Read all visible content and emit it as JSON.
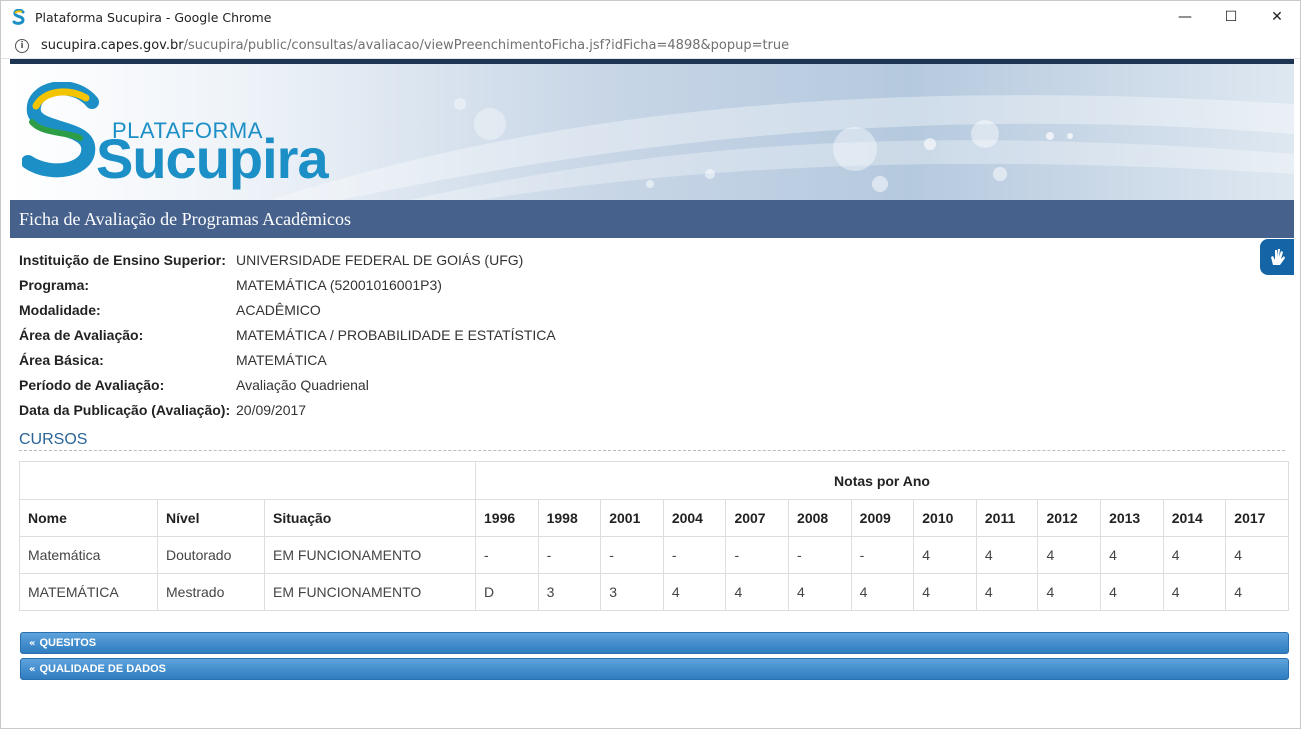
{
  "window": {
    "title": "Plataforma Sucupira - Google Chrome",
    "controls": {
      "minimize": "—",
      "maximize": "☐",
      "close": "✕"
    }
  },
  "address": {
    "domain": "sucupira.capes.gov.br",
    "path": "/sucupira/public/consultas/avaliacao/viewPreenchimentoFicha.jsf?idFicha=4898&popup=true"
  },
  "logo": {
    "small": "PLATAFORMA",
    "big": "Sucupira"
  },
  "section_title": "Ficha de Avaliação de Programas Acadêmicos",
  "details": [
    {
      "label": "Instituição de Ensino Superior:",
      "value": "UNIVERSIDADE FEDERAL DE GOIÁS (UFG)"
    },
    {
      "label": "Programa:",
      "value": "MATEMÁTICA (52001016001P3)"
    },
    {
      "label": "Modalidade:",
      "value": "ACADÊMICO"
    },
    {
      "label": "Área de Avaliação:",
      "value": "MATEMÁTICA / PROBABILIDADE E ESTATÍSTICA"
    },
    {
      "label": "Área Básica:",
      "value": "MATEMÁTICA"
    },
    {
      "label": "Período de Avaliação:",
      "value": "Avaliação Quadrienal"
    },
    {
      "label": "Data da Publicação (Avaliação):",
      "value": "20/09/2017"
    }
  ],
  "cursos": {
    "title": "CURSOS",
    "group_header": "Notas por Ano",
    "columns": [
      "Nome",
      "Nível",
      "Situação"
    ],
    "years": [
      "1996",
      "1998",
      "2001",
      "2004",
      "2007",
      "2008",
      "2009",
      "2010",
      "2011",
      "2012",
      "2013",
      "2014",
      "2017"
    ],
    "rows": [
      {
        "nome": "Matemática",
        "nivel": "Doutorado",
        "situacao": "EM FUNCIONAMENTO",
        "notas": [
          "-",
          "-",
          "-",
          "-",
          "-",
          "-",
          "-",
          "4",
          "4",
          "4",
          "4",
          "4",
          "4"
        ]
      },
      {
        "nome": "MATEMÁTICA",
        "nivel": "Mestrado",
        "situacao": "EM FUNCIONAMENTO",
        "notas": [
          "D",
          "3",
          "3",
          "4",
          "4",
          "4",
          "4",
          "4",
          "4",
          "4",
          "4",
          "4",
          "4"
        ]
      }
    ]
  },
  "accordion": [
    {
      "label": "QUESITOS"
    },
    {
      "label": "QUALIDADE DE DADOS"
    }
  ],
  "colors": {
    "header": "#46628c",
    "accent": "#1b8fc6",
    "accordion": "#2f7cc0"
  }
}
